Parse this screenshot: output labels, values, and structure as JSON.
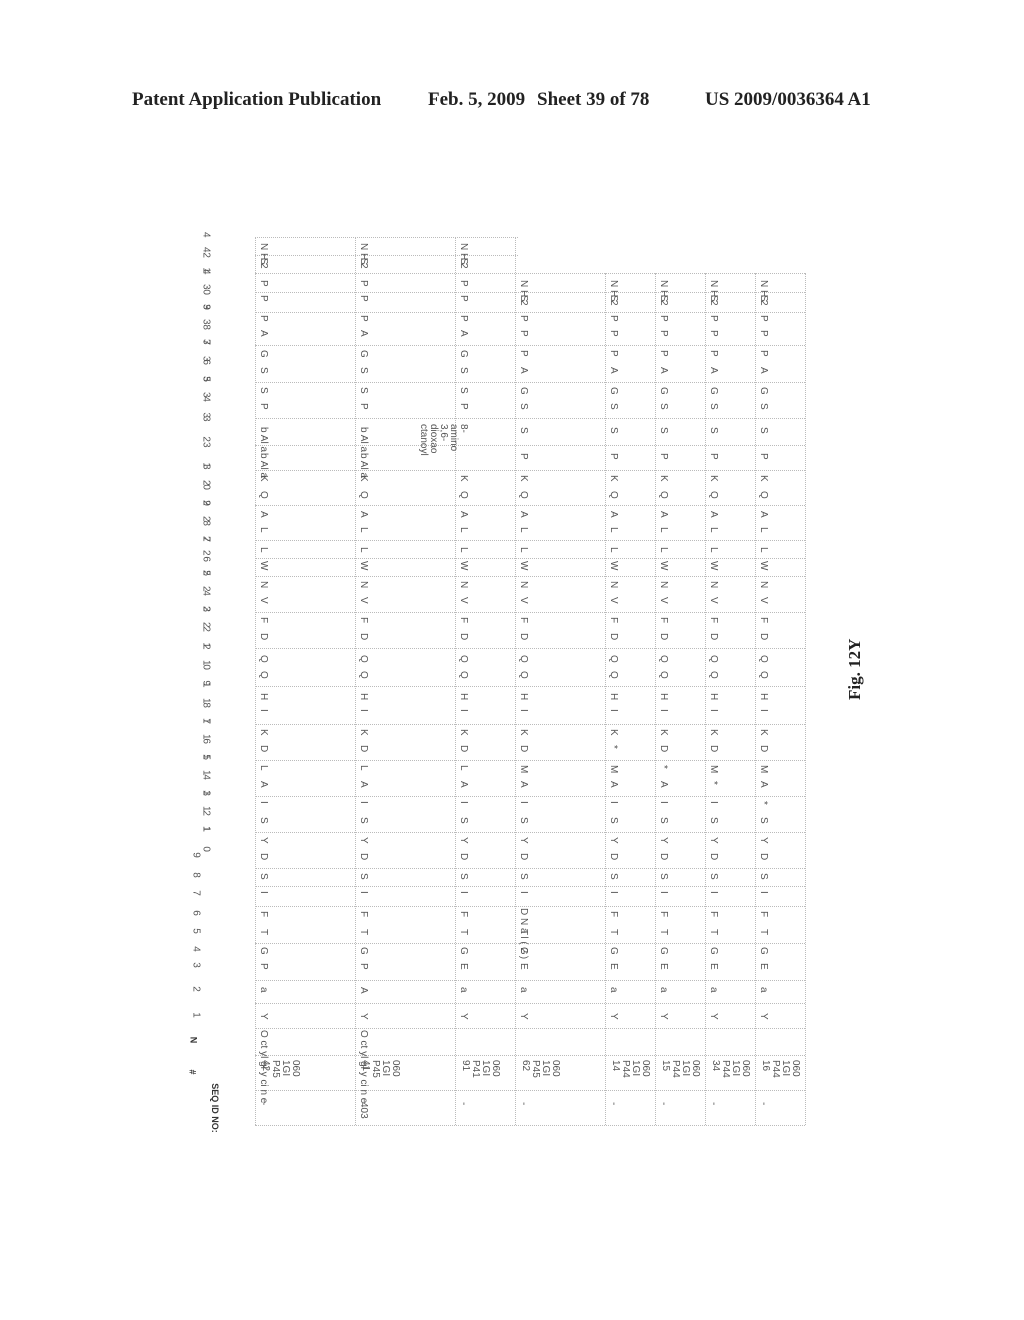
{
  "header": {
    "publication": "Patent Application Publication",
    "date": "Feb. 5, 2009",
    "sheet": "Sheet 39 of 78",
    "patent_number": "US 2009/0036364 A1"
  },
  "figure_label": "Fig. 12Y",
  "table": {
    "row_header_label": "SEQ ID NO:",
    "id_label": "#",
    "n_label": "N",
    "positions": [
      "42",
      "41",
      "40",
      "39",
      "38",
      "37",
      "36",
      "35",
      "34",
      "33",
      "32",
      "31",
      "30",
      "29",
      "28",
      "27",
      "26",
      "25",
      "24",
      "23",
      "22",
      "21",
      "20",
      "19",
      "18",
      "17",
      "16",
      "15",
      "14",
      "13",
      "12",
      "11",
      "10",
      "9",
      "8",
      "7",
      "6",
      "5",
      "4",
      "3",
      "2",
      "1"
    ],
    "columns": [
      {
        "seq_id": "-",
        "id": "0601GIP4542",
        "n_term": "Octylglycine",
        "residues": [
          "NH2",
          "S",
          "P",
          "P",
          "P",
          "A",
          "G",
          "S",
          "S",
          "P",
          "bAla",
          "bAla",
          "K",
          "Q",
          "A",
          "L",
          "L",
          "W",
          "N",
          "V",
          "F",
          "D",
          "Q",
          "Q",
          "H",
          "I",
          "K",
          "D",
          "L",
          "A",
          "I",
          "S",
          "Y",
          "D",
          "S",
          "I",
          "F",
          "T",
          "G",
          "P",
          "a",
          "Y"
        ]
      },
      {
        "seq_id": "403",
        "id": "0601GIP4541",
        "n_term": "Octylglycine",
        "residues": [
          "NH2",
          "S",
          "P",
          "P",
          "P",
          "A",
          "G",
          "S",
          "S",
          "P",
          "bAla",
          "bAla",
          "K",
          "Q",
          "A",
          "L",
          "L",
          "W",
          "N",
          "V",
          "F",
          "D",
          "Q",
          "Q",
          "H",
          "I",
          "K",
          "D",
          "L",
          "A",
          "I",
          "S",
          "Y",
          "D",
          "S",
          "I",
          "F",
          "T",
          "G",
          "P",
          "A",
          "Y"
        ]
      },
      {
        "seq_id": "-",
        "id": "0601GIP4191",
        "n_term": "",
        "residues": [
          "NH2",
          "S",
          "P",
          "P",
          "P",
          "A",
          "G",
          "S",
          "S",
          "P",
          "8-amino-3,6-dioxaoctanoyl",
          "",
          "K",
          "Q",
          "A",
          "L",
          "L",
          "W",
          "N",
          "V",
          "F",
          "D",
          "Q",
          "Q",
          "H",
          "I",
          "K",
          "D",
          "L",
          "A",
          "I",
          "S",
          "Y",
          "D",
          "S",
          "I",
          "F",
          "T",
          "G",
          "E",
          "a",
          "Y"
        ]
      },
      {
        "seq_id": "-",
        "id": "0601GIP4562",
        "n_term": "",
        "residues": [
          "",
          "",
          "NH2",
          "S",
          "P",
          "P",
          "P",
          "A",
          "G",
          "S",
          "S",
          "P",
          "K",
          "Q",
          "A",
          "L",
          "L",
          "W",
          "N",
          "V",
          "F",
          "D",
          "Q",
          "Q",
          "H",
          "I",
          "K",
          "D",
          "M",
          "A",
          "I",
          "S",
          "Y",
          "D",
          "S",
          "I",
          "DNal(2)",
          "T",
          "G",
          "E",
          "a",
          "Y"
        ]
      },
      {
        "seq_id": "-",
        "id": "0601GIP4414",
        "n_term": "",
        "residues": [
          "",
          "",
          "NH2",
          "S",
          "P",
          "P",
          "P",
          "A",
          "G",
          "S",
          "S",
          "P",
          "K",
          "Q",
          "A",
          "L",
          "L",
          "W",
          "N",
          "V",
          "F",
          "D",
          "Q",
          "Q",
          "H",
          "I",
          "K",
          "*",
          "M",
          "A",
          "I",
          "S",
          "Y",
          "D",
          "S",
          "I",
          "F",
          "T",
          "G",
          "E",
          "a",
          "Y"
        ]
      },
      {
        "seq_id": "-",
        "id": "0601GIP4415",
        "n_term": "",
        "residues": [
          "",
          "",
          "NH2",
          "S",
          "P",
          "P",
          "P",
          "A",
          "G",
          "S",
          "S",
          "P",
          "K",
          "Q",
          "A",
          "L",
          "L",
          "W",
          "N",
          "V",
          "F",
          "D",
          "Q",
          "Q",
          "H",
          "I",
          "K",
          "D",
          "*",
          "A",
          "I",
          "S",
          "Y",
          "D",
          "S",
          "I",
          "F",
          "T",
          "G",
          "E",
          "a",
          "Y"
        ]
      },
      {
        "seq_id": "-",
        "id": "0601GIP4434",
        "n_term": "",
        "residues": [
          "",
          "",
          "NH2",
          "S",
          "P",
          "P",
          "P",
          "A",
          "G",
          "S",
          "S",
          "P",
          "K",
          "Q",
          "A",
          "L",
          "L",
          "W",
          "N",
          "V",
          "F",
          "D",
          "Q",
          "Q",
          "H",
          "I",
          "K",
          "D",
          "M",
          "*",
          "I",
          "S",
          "Y",
          "D",
          "S",
          "I",
          "F",
          "T",
          "G",
          "E",
          "a",
          "Y"
        ]
      },
      {
        "seq_id": "-",
        "id": "0601GIP4416",
        "n_term": "",
        "residues": [
          "",
          "",
          "NH2",
          "S",
          "P",
          "P",
          "P",
          "A",
          "G",
          "S",
          "S",
          "P",
          "K",
          "Q",
          "A",
          "L",
          "L",
          "W",
          "N",
          "V",
          "F",
          "D",
          "Q",
          "Q",
          "H",
          "I",
          "K",
          "D",
          "M",
          "A",
          "*",
          "S",
          "Y",
          "D",
          "S",
          "I",
          "F",
          "T",
          "G",
          "E",
          "a",
          "Y"
        ]
      }
    ]
  }
}
